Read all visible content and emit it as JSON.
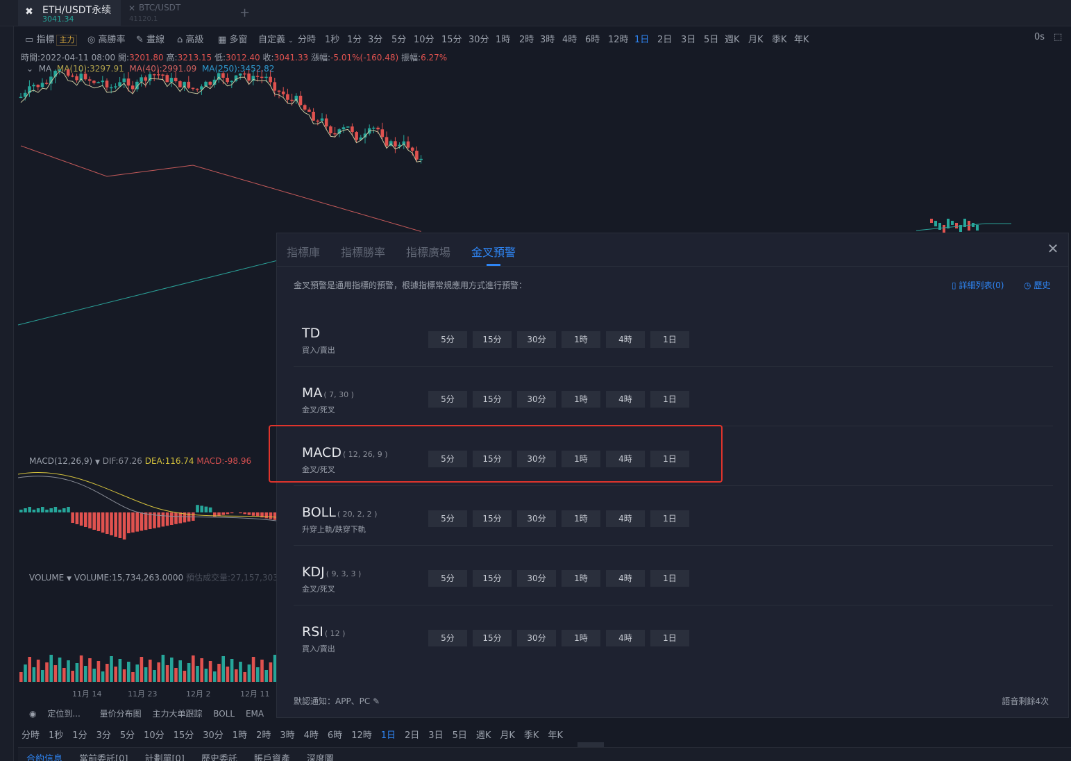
{
  "tabs": [
    {
      "title": "ETH/USDT永续",
      "price": "3041.34"
    },
    {
      "title": "BTC/USDT",
      "price": "41120.1"
    }
  ],
  "toolbar": {
    "indicators": "指標",
    "main_badge": "主力",
    "win_rate": "高勝率",
    "draw": "畫線",
    "advanced": "高級",
    "multi_window": "多窗",
    "custom": "自定義",
    "timeframes": [
      "分時",
      "1秒",
      "1分",
      "3分",
      "5分",
      "10分",
      "15分",
      "30分",
      "1時",
      "2時",
      "3時",
      "4時",
      "6時",
      "12時",
      "1日",
      "2日",
      "3日",
      "5日",
      "週K",
      "月K",
      "季K",
      "年K"
    ],
    "active_timeframe": "1日",
    "countdown": "0s"
  },
  "info_line": {
    "time_label": "時間:",
    "time": "2022-04-11 08:00",
    "open_label": "開:",
    "open": "3201.80",
    "high_label": "高:",
    "high": "3213.15",
    "low_label": "低:",
    "low": "3012.40",
    "close_label": "收:",
    "close": "3041.33",
    "change_label": "漲幅:",
    "change": "-5.01%(-160.48)",
    "amplitude_label": "振幅:",
    "amplitude": "6.27%"
  },
  "ma_line": {
    "label": "MA",
    "ma10": "MA(10):3297.91",
    "ma40": "MA(40):2991.09",
    "ma250": "MA(250):3452.82"
  },
  "macd_line": {
    "label": "MACD(12,26,9)",
    "dif": "DIF:67.26",
    "dea": "DEA:116.74",
    "macd": "MACD:-98.96"
  },
  "volume_line": {
    "label": "VOLUME",
    "volume": "VOLUME:15,734,263.0000",
    "estimate": "預估成交量:27,157,303"
  },
  "date_axis": [
    "11月 14",
    "11月 23",
    "12月 2",
    "12月 11"
  ],
  "bottom_tools": [
    "定位到...",
    "量价分布图",
    "主力大单跟踪",
    "BOLL",
    "EMA"
  ],
  "bottom_timeframes": [
    "分時",
    "1秒",
    "1分",
    "3分",
    "5分",
    "10分",
    "15分",
    "30分",
    "1時",
    "2時",
    "3時",
    "4時",
    "6時",
    "12時",
    "1日",
    "2日",
    "3日",
    "5日",
    "週K",
    "月K",
    "季K",
    "年K"
  ],
  "bottom_tabs": [
    "合約信息",
    "當前委託[0]",
    "計劃單[0]",
    "歷史委託",
    "賬戶資產",
    "深度圖"
  ],
  "modal": {
    "tabs": [
      "指標庫",
      "指標勝率",
      "指標廣場",
      "金叉預警"
    ],
    "active_tab": "金叉預警",
    "description": "金叉預警是通用指標的預警，根據指標常規應用方式進行預警：",
    "detail_link": "詳細列表(0)",
    "history_link": "歷史",
    "timeframes": [
      "5分",
      "15分",
      "30分",
      "1時",
      "4時",
      "1日"
    ],
    "indicators": [
      {
        "name": "TD",
        "params": "",
        "sub": "買入/賣出"
      },
      {
        "name": "MA",
        "params": "( 7, 30 )",
        "sub": "金叉/死叉"
      },
      {
        "name": "MACD",
        "params": "( 12, 26, 9 )",
        "sub": "金叉/死叉"
      },
      {
        "name": "BOLL",
        "params": "( 20, 2, 2 )",
        "sub": "升穿上軌/跌穿下軌"
      },
      {
        "name": "KDJ",
        "params": "( 9, 3, 3 )",
        "sub": "金叉/死叉"
      },
      {
        "name": "RSI",
        "params": "( 12 )",
        "sub": "買入/賣出"
      }
    ],
    "footer_left": "默認通知：APP、PC",
    "footer_right": "語音剩餘4次"
  },
  "colors": {
    "accent": "#2f86f5",
    "up": "#26a69a",
    "down": "#e0524f",
    "highlight": "#e0342c"
  }
}
